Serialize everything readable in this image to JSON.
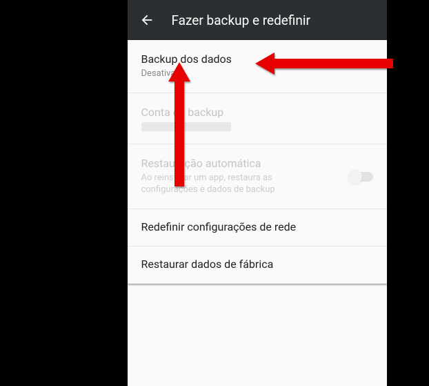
{
  "header": {
    "title": "Fazer backup e redefinir"
  },
  "items": {
    "backup_data": {
      "title": "Backup dos dados",
      "subtitle": "Desativado"
    },
    "backup_account": {
      "title": "Conta de backup"
    },
    "auto_restore": {
      "title": "Restauração automática",
      "subtitle": "Ao reinstalar um app, restaura as configurações e dados de backup"
    },
    "network_reset": {
      "title": "Redefinir configurações de rede"
    },
    "factory_reset": {
      "title": "Restaurar dados de fábrica"
    }
  },
  "annotations": {
    "arrow_color": "#e60000"
  }
}
